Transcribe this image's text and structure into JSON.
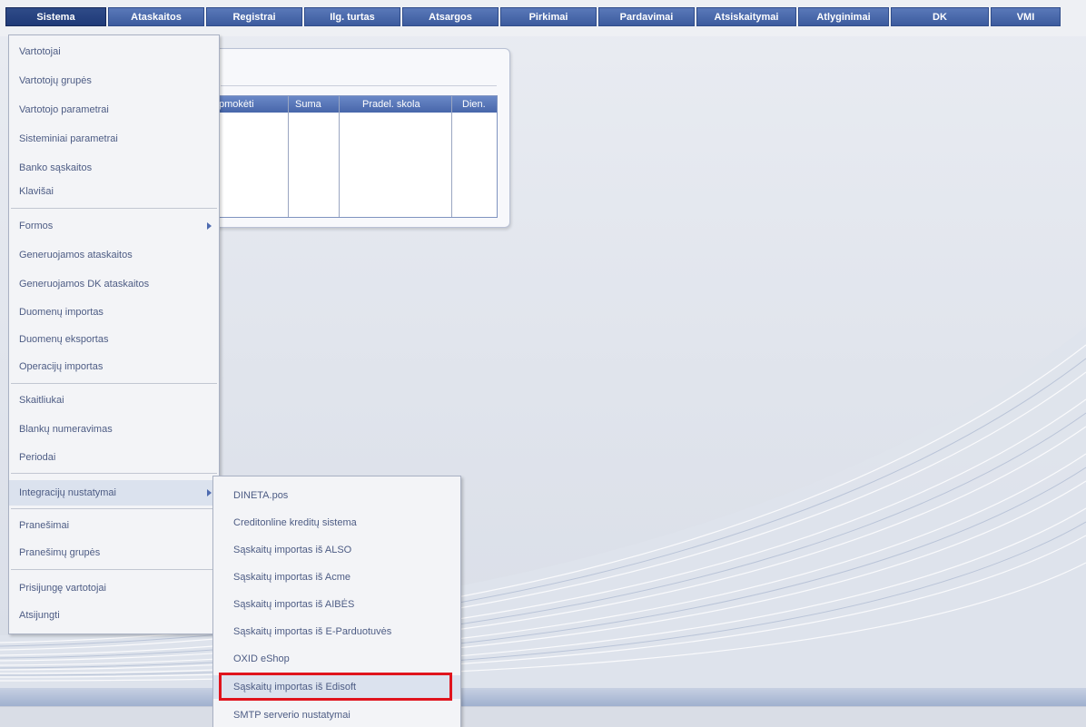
{
  "top_menu": [
    "Sistema",
    "Ataskaitos",
    "Registrai",
    "Ilg. turtas",
    "Atsargos",
    "Pirkimai",
    "Pardavimai",
    "Atsiskaitymai",
    "Atlyginimai",
    "DK",
    "VMI"
  ],
  "background_panel": {
    "columns": [
      "pmokėti",
      "Suma",
      "Pradel. skola",
      "Dien."
    ]
  },
  "sistema_menu": {
    "group1": [
      "Vartotojai",
      "Vartotojų grupės",
      "Vartotojo parametrai",
      "Sisteminiai parametrai",
      "Banko sąskaitos",
      "Klavišai"
    ],
    "group2": [
      "Formos",
      "Generuojamos ataskaitos",
      "Generuojamos DK ataskaitos",
      "Duomenų importas",
      "Duomenų eksportas",
      "Operacijų importas"
    ],
    "group3": [
      "Skaitliukai",
      "Blankų numeravimas",
      "Periodai"
    ],
    "group4": [
      "Integracijų nustatymai"
    ],
    "group5": [
      "Pranešimai",
      "Pranešimų grupės"
    ],
    "group6": [
      "Prisijungę vartotojai",
      "Atsijungti"
    ]
  },
  "integrations_submenu": [
    "DINETA.pos",
    "Creditonline kreditų sistema",
    "Sąskaitų importas iš ALSO",
    "Sąskaitų importas iš Acme",
    "Sąskaitų importas iš AIBĖS",
    "Sąskaitų importas iš E-Parduotuvės",
    "OXID eShop",
    "Sąskaitų importas iš Edisoft",
    "SMTP serverio nustatymai"
  ],
  "highlighted_item": "Sąskaitų importas iš Edisoft",
  "colors": {
    "menu_bar": "#3c5b9e",
    "menu_bar_active": "#1f3a78",
    "highlight": "#e0141d"
  }
}
